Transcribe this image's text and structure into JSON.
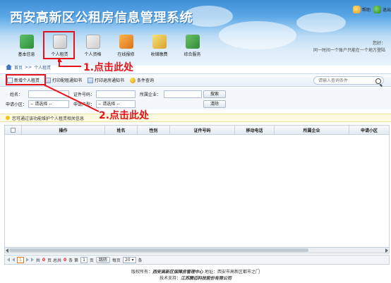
{
  "header": {
    "title": "西安高新区公租房信息管理系统",
    "help_label": "帮助",
    "exit_label": "退出",
    "user_label": "您好：",
    "login_info": "同一时间一个账户只能在一个地方登陆"
  },
  "nav": [
    {
      "label": "基本信息",
      "icon": "basic-info-icon"
    },
    {
      "label": "个人租赁",
      "icon": "personal-rent-icon"
    },
    {
      "label": "个人资格",
      "icon": "personal-qualification-icon"
    },
    {
      "label": "在线报修",
      "icon": "online-repair-icon"
    },
    {
      "label": "收储缴费",
      "icon": "fee-payment-icon"
    },
    {
      "label": "综合服务",
      "icon": "integrated-service-icon"
    }
  ],
  "breadcrumb": {
    "home": "首页",
    "sep": ">>",
    "current": "个人租赁"
  },
  "toolbar": {
    "add_label": "新增个人租赁",
    "print_notice_label": "打印配租通知书",
    "print_checkout_label": "打印退房通知书",
    "query_label": "条件查询",
    "search_placeholder": "请输入查询条件"
  },
  "filters": {
    "name_label": "姓名：",
    "id_label": "证件号码：",
    "company_label": "所属企业：",
    "search_button": "搜索",
    "community_label": "申请小区：",
    "community_value": "-- 请选择 --",
    "type_label": "申请户型：",
    "type_value": "-- 请选择 --",
    "clear_button": "清除"
  },
  "notice": "您可通过该功能维护个人租赁相关信息",
  "table": {
    "columns": [
      "操作",
      "姓名",
      "性别",
      "证件号码",
      "移动电话",
      "所属企业",
      "申请小区"
    ]
  },
  "pager": {
    "current_page": "1",
    "total_pages": "0",
    "total_records": "0",
    "page_label_prefix": "共",
    "page_label_suffix": "页 总共",
    "records_suffix": "条 第",
    "page_input": "1",
    "page_suffix": "页",
    "go_label": "跳转",
    "per_page_label": "每页",
    "per_page_value": "20",
    "per_page_suffix": "条"
  },
  "footer": {
    "line1_prefix": "版权所有：",
    "owner": "西安高新区保障房管理中心",
    "address_prefix": " 地址：",
    "address": "西安市高新区都市之门",
    "line2_prefix": "技术支持：",
    "support": "江苏腾迈科技股份有限公司"
  },
  "annotations": {
    "step1": "1.点击此处",
    "step2": "2.点击此处",
    "color": "#e8121a"
  }
}
